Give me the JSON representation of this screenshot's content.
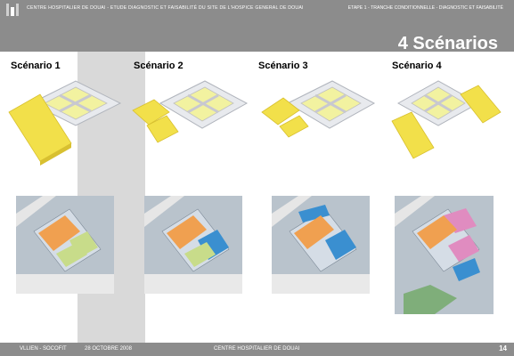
{
  "header": {
    "left_text": "CENTRE HOSPITALIER DE DOUAI - ETUDE DIAGNOSTIC ET FAISABILITÉ DU SITE DE L'HOSPICE GENERAL DE DOUAI",
    "right_text": "ETAPE 1 - TRANCHE CONDITIONNELLE - DIAGNOSTIC ET FAISABILITÉ"
  },
  "page_title": "4 Scénarios",
  "scenarios": [
    {
      "label": "Scénario 1"
    },
    {
      "label": "Scénario 2"
    },
    {
      "label": "Scénario 3"
    },
    {
      "label": "Scénario 4"
    }
  ],
  "footer": {
    "author": "VLLIEN - SOCOFIT",
    "date": "28 OCTOBRE  2008",
    "center": "CENTRE HOSPITALIER DE DOUAI",
    "page": "14"
  },
  "colors": {
    "band": "#8c8c8c",
    "highlight_column": "#d9d9d9",
    "new_building_yellow": "#f2e04a",
    "plan_orange": "#f0a050",
    "plan_blue": "#3a8fd0",
    "plan_green": "#c8dc8a",
    "plan_pink": "#e08cc0"
  }
}
